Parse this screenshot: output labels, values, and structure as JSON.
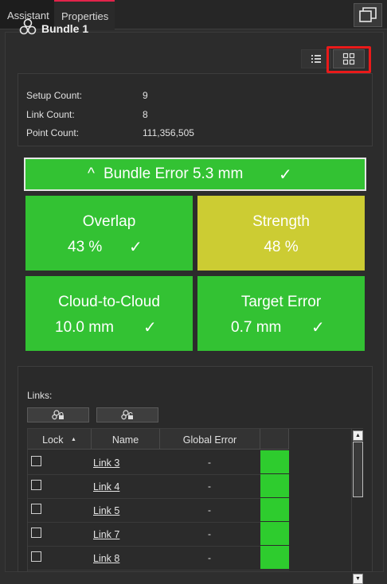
{
  "tabs": {
    "assistant": "Assistant",
    "properties": "Properties"
  },
  "bundle": {
    "title": "Bundle 1"
  },
  "stats": [
    {
      "label": "Setup Count:",
      "value": "9"
    },
    {
      "label": "Link Count:",
      "value": "8"
    },
    {
      "label": "Point Count:",
      "value": "111,356,505"
    }
  ],
  "bundle_error": {
    "caret": "^",
    "label": "Bundle Error 5.3 mm",
    "check": "✓"
  },
  "tiles": {
    "overlap": {
      "title": "Overlap",
      "value": "43 %",
      "check": "✓",
      "color": "#33c233"
    },
    "strength": {
      "title": "Strength",
      "value": "48 %",
      "color": "#cccc33"
    },
    "cloud": {
      "title": "Cloud-to-Cloud",
      "value": "10.0 mm",
      "check": "✓",
      "color": "#33c233"
    },
    "target": {
      "title": "Target Error",
      "value": "0.7 mm",
      "check": "✓",
      "color": "#33c233"
    }
  },
  "links": {
    "label": "Links:",
    "columns": {
      "lock": "Lock",
      "name": "Name",
      "global_error": "Global Error",
      "sort_glyph": "▲"
    },
    "rows": [
      {
        "name": "Link 3",
        "global_error": "-"
      },
      {
        "name": "Link 4",
        "global_error": "-"
      },
      {
        "name": "Link 5",
        "global_error": "-"
      },
      {
        "name": "Link 7",
        "global_error": "-"
      },
      {
        "name": "Link 8",
        "global_error": "-"
      }
    ],
    "scroll_up": "▲",
    "scroll_down": "▼"
  },
  "icons": {
    "bundle": "bundle-icon",
    "list_view": "list-view-icon",
    "grid_view": "grid-view-icon",
    "detach": "detach-window-icon",
    "lock_link": "lock-link-icon",
    "unlock_link": "unlock-link-icon"
  },
  "colors": {
    "ok": "#33c233",
    "warning": "#cccc33",
    "highlight": "#ea1a1a",
    "tab_accent": "#e2234a"
  }
}
